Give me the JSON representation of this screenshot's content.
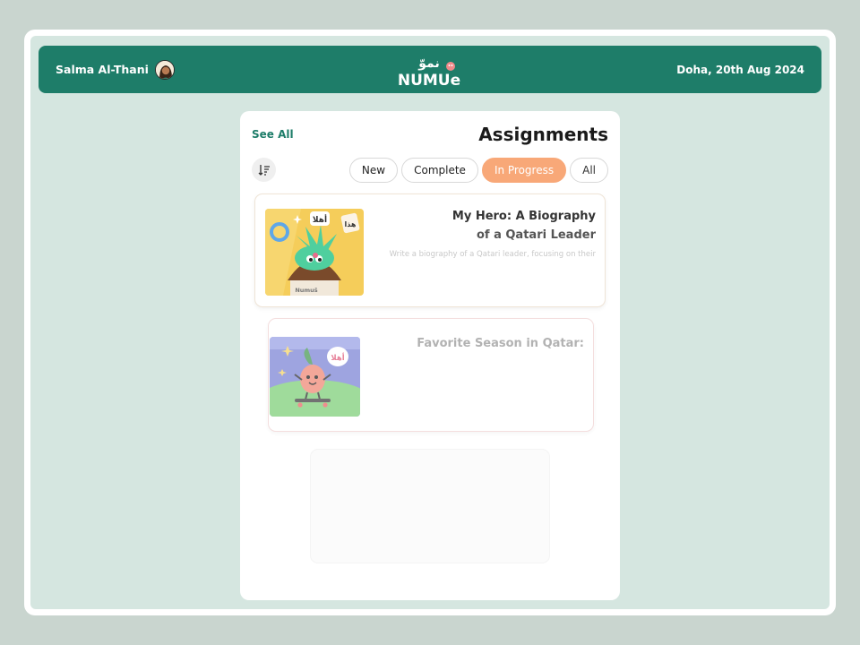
{
  "header": {
    "user_name": "Salma Al-Thani",
    "logo_arabic": "نموّ",
    "logo_latin": "NUMUe",
    "date": "Doha, 20th Aug 2024"
  },
  "assignments": {
    "see_all": "See All",
    "title": "Assignments",
    "filters": [
      {
        "label": "New",
        "active": false
      },
      {
        "label": "Complete",
        "active": false
      },
      {
        "label": "In Progress",
        "active": true
      },
      {
        "label": "All",
        "active": false
      }
    ],
    "cards": [
      {
        "title_line1": "My Hero: A Biography",
        "title_line2": "of a Qatari Leader",
        "description": "Write a biography of a Qatari leader, focusing on their",
        "thumb_speech1": "أهلا",
        "thumb_speech2": "هذا",
        "thumb_brand": "Numuš"
      },
      {
        "title_line1": "Favorite Season in Qatar:",
        "thumb_speech1": "أهلا"
      }
    ]
  },
  "colors": {
    "brand_green": "#1e7d69",
    "accent_orange": "#f8a878",
    "app_background": "#d5e6e0"
  },
  "icons": {
    "sort": "sort-descending-icon"
  }
}
